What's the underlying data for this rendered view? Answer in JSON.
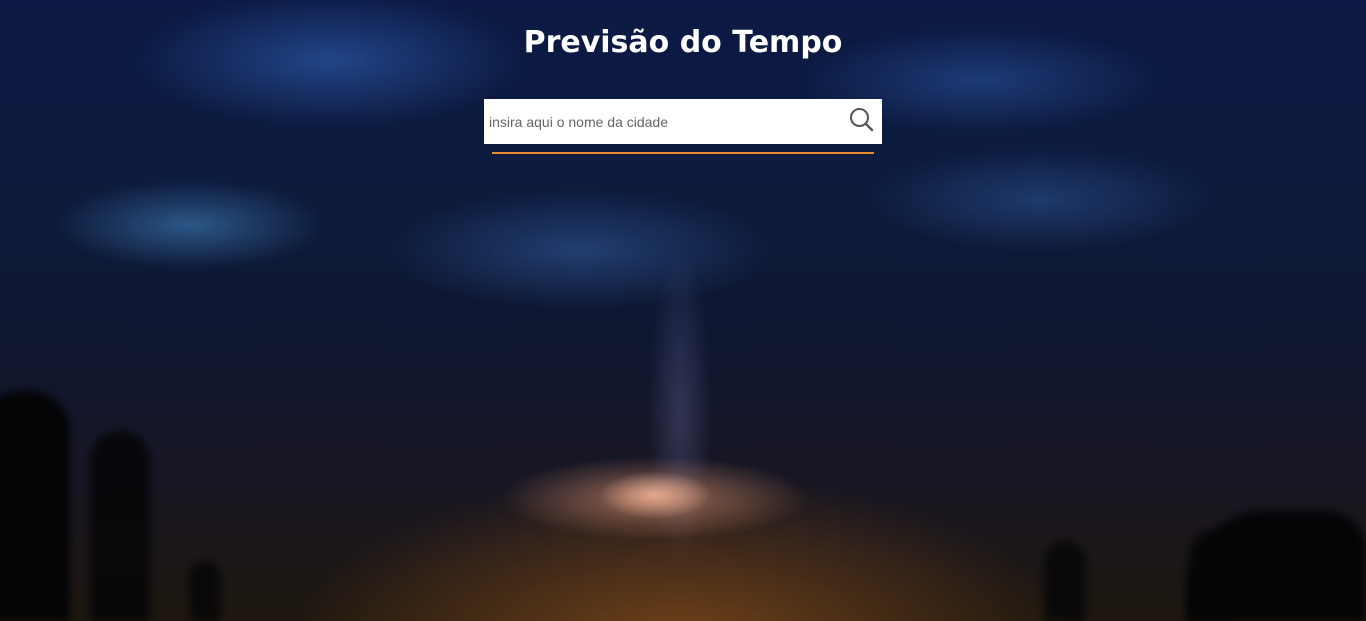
{
  "header": {
    "title": "Previsão do Tempo"
  },
  "search": {
    "placeholder": "insira aqui o nome da cidade",
    "value": "",
    "icon": "search-icon"
  },
  "colors": {
    "title_text": "#ffffff",
    "search_background": "#ffffff",
    "underline_accent": "#e8892f",
    "icon_stroke": "#555555"
  }
}
